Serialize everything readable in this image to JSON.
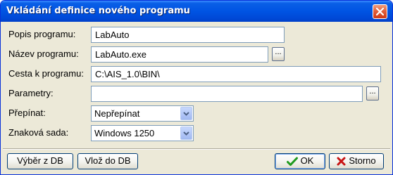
{
  "window": {
    "title": "Vkládání definice nového programu"
  },
  "form": {
    "popis_label": "Popis programu:",
    "popis_value": "LabAuto",
    "nazev_label": "Název programu:",
    "nazev_value": "LabAuto.exe",
    "cesta_label": "Cesta k programu:",
    "cesta_value": "C:\\AIS_1.0\\BIN\\",
    "parametry_label": "Parametry:",
    "parametry_value": "",
    "prepinat_label": "Přepínat:",
    "prepinat_value": "Nepřepínat",
    "znakova_label": "Znaková sada:",
    "znakova_value": "Windows 1250",
    "browse_label": "..."
  },
  "buttons": {
    "vyber": "Výběr z DB",
    "vloz": "Vlož do DB",
    "ok": "OK",
    "storno": "Storno"
  },
  "colors": {
    "title_bar": "#0054e3",
    "dialog_bg": "#ece9d8",
    "ok_check": "#1e9a1e",
    "cancel_x": "#c81414"
  }
}
